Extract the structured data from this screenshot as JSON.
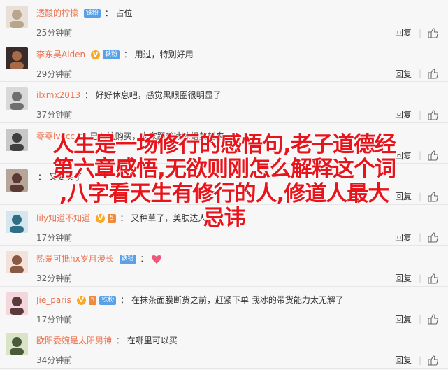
{
  "comments": [
    {
      "user": "透酸的柠檬",
      "badges": [
        "fan"
      ],
      "fan_label": "铁粉",
      "level_label": "",
      "text": "占位",
      "time": "25分钟前",
      "avatar_colors": [
        "#e8e0d8",
        "#b9a58c"
      ]
    },
    {
      "user": "李东昊Aiden",
      "badges": [
        "v",
        "fan"
      ],
      "fan_label": "铁粉",
      "level_label": "",
      "text": "用过，特别好用",
      "time": "29分钟前",
      "avatar_colors": [
        "#3a2b2b",
        "#a86b4a"
      ]
    },
    {
      "user": "ilxmx2013",
      "badges": [],
      "fan_label": "",
      "level_label": "",
      "text": "好好休息吧，感觉黑眼圈很明显了",
      "time": "37分钟前",
      "avatar_colors": [
        "#d9d9d9",
        "#6f6f6f"
      ]
    },
    {
      "user": "零零lvecc",
      "badges": [],
      "fan_label": "",
      "level_label": "",
      "text": "已入坑购买，大家跟着冰冰姐美起来",
      "time": "",
      "avatar_colors": [
        "#c8c8c8",
        "#404040"
      ]
    },
    {
      "user": "",
      "badges": [],
      "fan_label": "",
      "level_label": "",
      "text": "又要买了",
      "time": "",
      "avatar_colors": [
        "#b8a59a",
        "#5a3a33"
      ]
    },
    {
      "user": "lily知道不知道",
      "badges": [
        "v",
        "lv"
      ],
      "fan_label": "",
      "level_label": "5",
      "text": "又种草了，美肤达人",
      "time": "17分钟前",
      "avatar_colors": [
        "#d6e6ef",
        "#2f6f86"
      ]
    },
    {
      "user": "热爱可抵hx岁月漫长",
      "badges": [
        "fan"
      ],
      "fan_label": "铁粉",
      "level_label": "",
      "text": "",
      "time": "32分钟前",
      "avatar_colors": [
        "#f2e2da",
        "#8b5a44"
      ]
    },
    {
      "user": "Jie_paris",
      "badges": [
        "v",
        "lv",
        "fan"
      ],
      "fan_label": "铁粉",
      "level_label": "5",
      "text": "在抹茶面膜断货之前，赶紧下单  我冰的带货能力太无解了",
      "time": "17分钟前",
      "avatar_colors": [
        "#f4d7dd",
        "#5a3a3a"
      ]
    },
    {
      "user": "欧阳委婉是太阳男神",
      "badges": [],
      "fan_label": "",
      "level_label": "",
      "text": "在哪里可以买",
      "time": "34分钟前",
      "avatar_colors": [
        "#d9e4c7",
        "#4a5a3a"
      ]
    }
  ],
  "actions": {
    "reply": "回复"
  },
  "overlay": {
    "lines": [
      "人生是一场修行的感悟句,老子道德经",
      "第六章感悟,无欲则刚怎么解释这个词",
      ",八字看天生有修行的人,修道人最大",
      "忌讳"
    ]
  },
  "colors": {
    "username": "#eb7350",
    "overlay_text": "#e8141b",
    "background": "#f7f7f7"
  }
}
